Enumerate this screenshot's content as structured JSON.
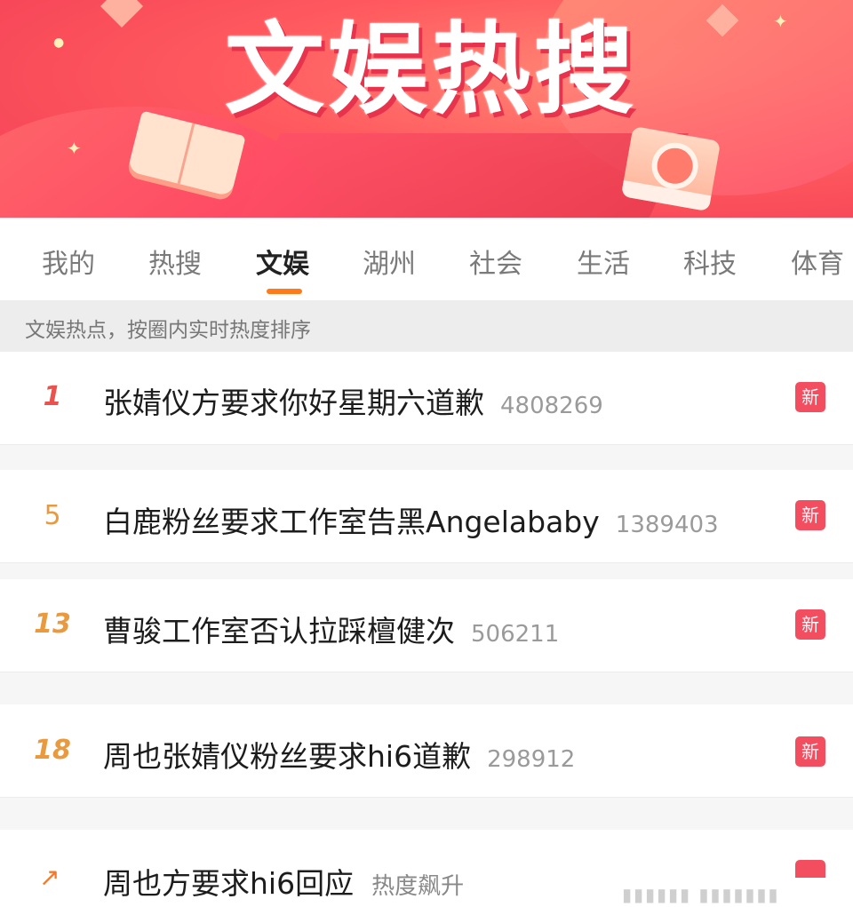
{
  "banner": {
    "title": "文娱热搜"
  },
  "tabs": [
    {
      "label": "我的"
    },
    {
      "label": "热搜"
    },
    {
      "label": "文娱",
      "active": true
    },
    {
      "label": "湖州"
    },
    {
      "label": "社会"
    },
    {
      "label": "生活"
    },
    {
      "label": "科技"
    },
    {
      "label": "体育"
    }
  ],
  "section": {
    "description": "文娱热点，按圈内实时热度排序"
  },
  "list": [
    {
      "rank": "1",
      "title": "张婧仪方要求你好星期六道歉",
      "count": "4808269",
      "badge": "新"
    },
    {
      "rank": "5",
      "title": "白鹿粉丝要求工作室告黑Angelababy",
      "count": "1389403",
      "badge": "新"
    },
    {
      "rank": "13",
      "title": "曹骏工作室否认拉踩檀健次",
      "count": "506211",
      "badge": "新"
    },
    {
      "rank": "18",
      "title": "周也张婧仪粉丝要求hi6道歉",
      "count": "298912",
      "badge": "新"
    },
    {
      "rank": "↗",
      "title": "周也方要求hi6回应",
      "status": "热度飙升"
    }
  ],
  "colors": {
    "accent": "#ff7b1a",
    "badge": "#f24e60",
    "rank_top": "#e8534f",
    "rank": "#e99a3e"
  }
}
